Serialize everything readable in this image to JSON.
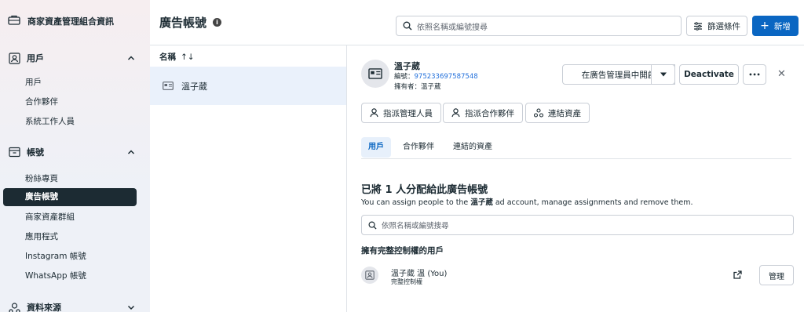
{
  "sidebar": {
    "header": "商家資產管理組合資訊",
    "sections": [
      {
        "label": "用戶",
        "items": [
          "用戶",
          "合作夥伴",
          "系統工作人員"
        ]
      },
      {
        "label": "帳號",
        "items": [
          "粉絲專頁",
          "廣告帳號",
          "商家資產群組",
          "應用程式",
          "Instagram 帳號",
          "WhatsApp 帳號"
        ]
      },
      {
        "label": "資料來源"
      }
    ],
    "active_item": "廣告帳號"
  },
  "topbar": {
    "title": "廣告帳號",
    "search_placeholder": "依照名稱或編號搜尋",
    "filter_label": "篩選條件",
    "add_label": "新增"
  },
  "list": {
    "column_header": "名稱",
    "sort_icon": "↑↓",
    "items": [
      {
        "name": "溫子葳"
      }
    ]
  },
  "detail": {
    "name": "溫子葳",
    "id_label": "編號：",
    "id_value": "975233697587548",
    "owner_label": "擁有者：溫子葳",
    "open_in_manager": "在廣告管理員中開啟",
    "deactivate": "Deactivate",
    "more": "•••",
    "close": "✕",
    "actions": [
      "指派管理人員",
      "指派合作夥伴",
      "連結資產"
    ],
    "tabs": [
      "用戶",
      "合作夥伴",
      "連結的資產"
    ],
    "active_tab": 0,
    "assigned_title": "已將 1 人分配給此廣告帳號",
    "assigned_desc_prefix": "You can assign people to the ",
    "assigned_desc_name": "溫子葳",
    "assigned_desc_suffix": " ad account, manage assignments and remove them.",
    "search_placeholder": "依照名稱或編號搜尋",
    "full_control_heading": "擁有完整控制權的用戶",
    "users": [
      {
        "name": "溫子葳 溫 (You)",
        "role": "完整控制權",
        "manage": "管理"
      }
    ]
  },
  "colors": {
    "accent": "#0a66c2",
    "active_nav": "#1c2b33",
    "link": "#216fdb"
  }
}
